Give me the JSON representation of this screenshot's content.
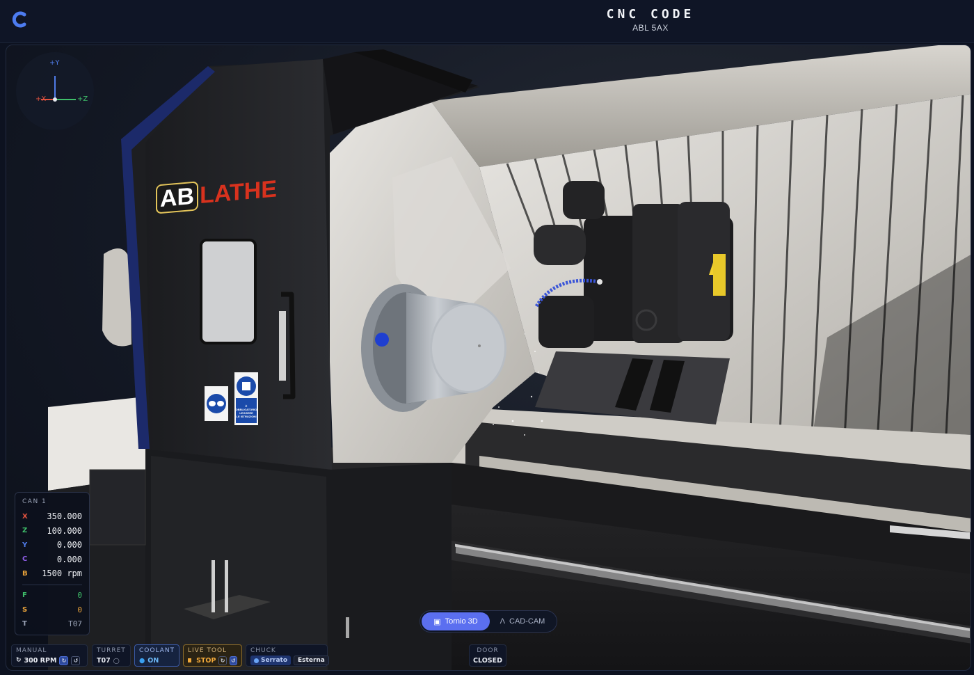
{
  "header": {
    "title": "CNC CODE",
    "subtitle": "ABL 5AX"
  },
  "gizmo": {
    "y_label": "+Y",
    "x_label": "+X",
    "z_label": "+Z"
  },
  "machine": {
    "brand_ab": "AB",
    "brand_lathe": "LATHE",
    "sticker_text_1": "È OBBLIGATORIO",
    "sticker_text_2": "LEGGERE",
    "sticker_text_3": "LE ISTRUZIONI"
  },
  "coords": {
    "header": "CAN 1",
    "axes": [
      {
        "axis": "X",
        "value": "350.000",
        "color": "#e2533f"
      },
      {
        "axis": "Z",
        "value": "100.000",
        "color": "#3fbf6a"
      },
      {
        "axis": "Y",
        "value": "0.000",
        "color": "#4f7be8"
      },
      {
        "axis": "C",
        "value": "0.000",
        "color": "#8f5ee8"
      },
      {
        "axis": "B",
        "value": "1500 rpm",
        "color": "#e8a23a"
      }
    ],
    "extras": [
      {
        "axis": "F",
        "value": "0",
        "color": "#3fbf6a"
      },
      {
        "axis": "S",
        "value": "0",
        "color": "#e8a23a"
      },
      {
        "axis": "T",
        "value": "T07",
        "color": "#9aa3b6"
      }
    ]
  },
  "mode_toggle": {
    "active_label": "Tornio 3D",
    "inactive_label": "CAD-CAM"
  },
  "status": {
    "manual": {
      "label": "MANUAL",
      "value": "300 RPM"
    },
    "turret": {
      "label": "TURRET",
      "value": "T07"
    },
    "coolant": {
      "label": "COOLANT",
      "value": "ON"
    },
    "live_tool": {
      "label": "LIVE TOOL",
      "value": "STOP"
    },
    "chuck": {
      "label": "CHUCK",
      "value_1": "Serrato",
      "value_2": "Esterna"
    },
    "door": {
      "label": "DOOR",
      "value": "CLOSED"
    }
  },
  "colors": {
    "accent": "#5b6ff0",
    "coolant": "#3aa0f0",
    "live_tool": "#f0a83a",
    "brand_red": "#d8321e"
  }
}
